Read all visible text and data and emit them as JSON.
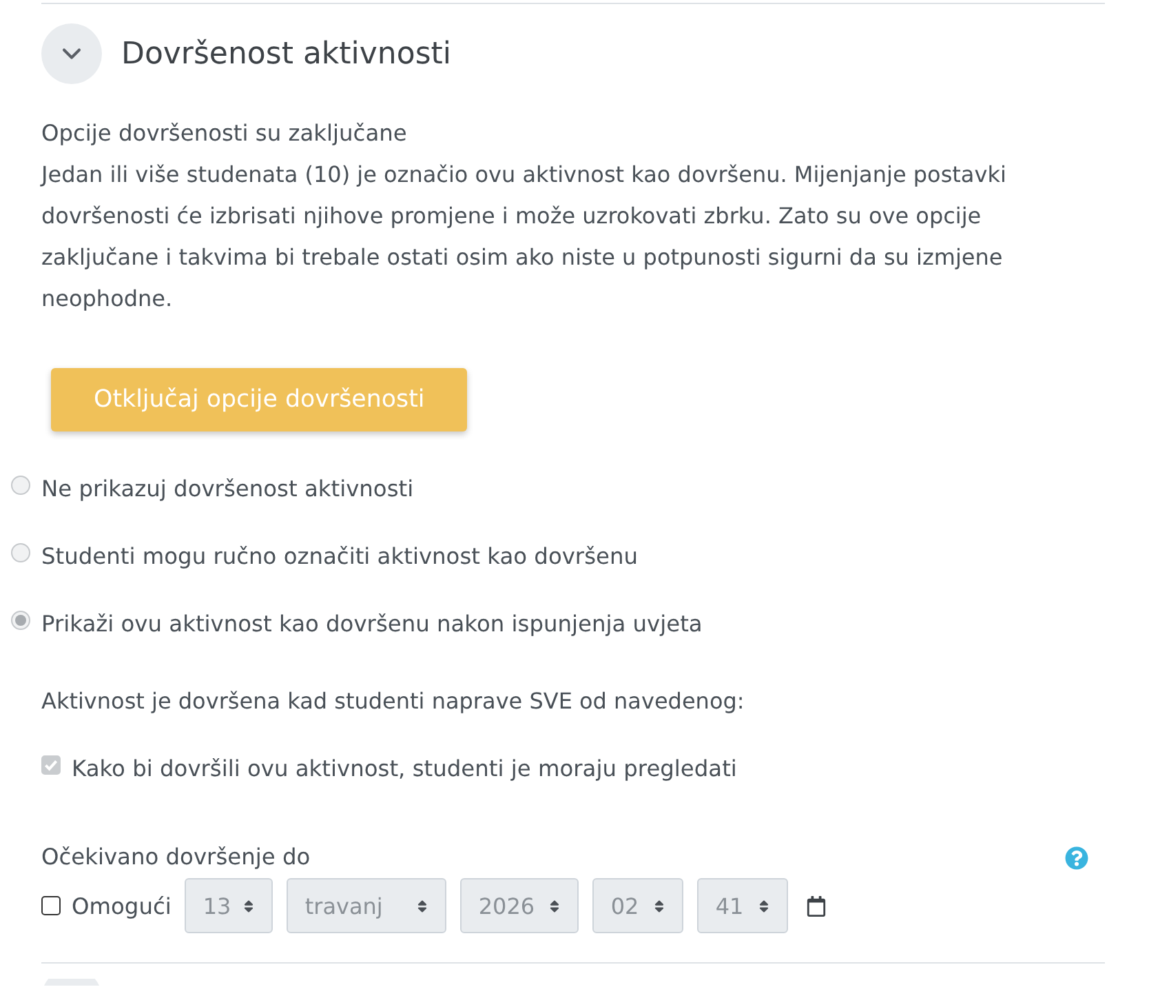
{
  "section": {
    "title": "Dovršenost aktivnosti",
    "expanded": true
  },
  "lock_notice": {
    "heading": "Opcije dovršenosti su zaključane",
    "text": "Jedan ili više studenata (10) je označio ovu aktivnost kao dovršenu. Mijenjanje postavki dovršenosti će izbrisati njihove promjene i može uzrokovati zbrku. Zato su ove opcije zaključane i takvima bi trebale ostati osim ako niste u potpunosti sigurni da su izmjene neophodne."
  },
  "unlock_button": {
    "label": "Otključaj opcije dovršenosti"
  },
  "completion_options": [
    {
      "label": "Ne prikazuj dovršenost aktivnosti",
      "selected": false,
      "disabled": true
    },
    {
      "label": "Studenti mogu ručno označiti aktivnost kao dovršenu",
      "selected": false,
      "disabled": true
    },
    {
      "label": "Prikaži ovu aktivnost kao dovršenu nakon ispunjenja uvjeta",
      "selected": true,
      "disabled": true
    }
  ],
  "conditions": {
    "heading": "Aktivnost je dovršena kad studenti naprave SVE od navedenog:",
    "items": [
      {
        "label": "Kako bi dovršili ovu aktivnost, studenti je moraju pregledati",
        "checked": true,
        "disabled": true
      }
    ]
  },
  "expected_completion": {
    "label": "Očekivano dovršenje do",
    "enable": {
      "label": "Omogući",
      "checked": false
    },
    "fields": [
      {
        "kind": "day",
        "value": "13",
        "disabled": true
      },
      {
        "kind": "month",
        "value": "travanj",
        "disabled": true
      },
      {
        "kind": "year",
        "value": "2026",
        "disabled": true
      },
      {
        "kind": "hour",
        "value": "02",
        "disabled": true
      },
      {
        "kind": "minute",
        "value": "41",
        "disabled": true
      }
    ]
  }
}
